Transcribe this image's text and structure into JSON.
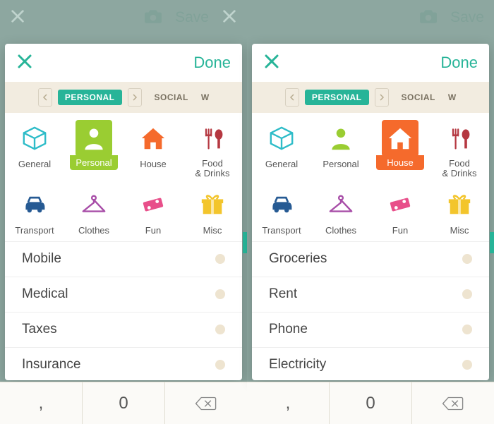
{
  "screens": [
    {
      "header": {
        "save": "Save"
      },
      "sheet": {
        "done": "Done"
      },
      "tabs": {
        "active": "PERSONAL",
        "next": "SOCIAL",
        "cut": "W"
      },
      "categories": [
        {
          "label": "General",
          "icon": "cube",
          "color": "#2dbcc8"
        },
        {
          "label": "Personal",
          "icon": "person",
          "color": "#ffffff",
          "selected": "green"
        },
        {
          "label": "House",
          "icon": "house",
          "color": "#f56a2c"
        },
        {
          "label": "Food\n& Drinks",
          "icon": "food",
          "color": "#b53841"
        },
        {
          "label": "Transport",
          "icon": "car",
          "color": "#265a93"
        },
        {
          "label": "Clothes",
          "icon": "hanger",
          "color": "#a84ea8"
        },
        {
          "label": "Fun",
          "icon": "ticket",
          "color": "#e84f8a"
        },
        {
          "label": "Misc",
          "icon": "gift",
          "color": "#f3c52c"
        }
      ],
      "subcats": [
        "Mobile",
        "Medical",
        "Taxes",
        "Insurance"
      ],
      "keyboard": {
        "comma": ",",
        "zero": "0"
      }
    },
    {
      "header": {
        "save": "Save"
      },
      "sheet": {
        "done": "Done"
      },
      "tabs": {
        "active": "PERSONAL",
        "next": "SOCIAL",
        "cut": "W"
      },
      "categories": [
        {
          "label": "General",
          "icon": "cube",
          "color": "#2dbcc8"
        },
        {
          "label": "Personal",
          "icon": "person",
          "color": "#9acd32"
        },
        {
          "label": "House",
          "icon": "house",
          "color": "#ffffff",
          "selected": "orange"
        },
        {
          "label": "Food\n& Drinks",
          "icon": "food",
          "color": "#b53841"
        },
        {
          "label": "Transport",
          "icon": "car",
          "color": "#265a93"
        },
        {
          "label": "Clothes",
          "icon": "hanger",
          "color": "#a84ea8"
        },
        {
          "label": "Fun",
          "icon": "ticket",
          "color": "#e84f8a"
        },
        {
          "label": "Misc",
          "icon": "gift",
          "color": "#f3c52c"
        }
      ],
      "subcats": [
        "Groceries",
        "Rent",
        "Phone",
        "Electricity"
      ],
      "keyboard": {
        "comma": ",",
        "zero": "0"
      }
    }
  ]
}
